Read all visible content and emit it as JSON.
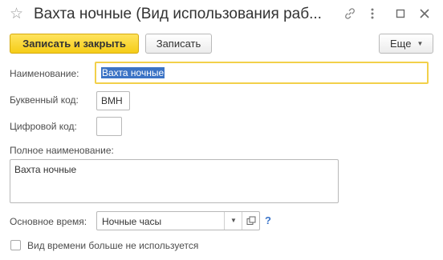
{
  "window": {
    "title": "Вахта ночные (Вид использования раб...",
    "star_icon": "star-icon",
    "link_icon": "link-icon",
    "more_icon": "kebab-icon",
    "restore_icon": "restore-icon",
    "close_icon": "close-icon"
  },
  "toolbar": {
    "save_close_label": "Записать и закрыть",
    "save_label": "Записать",
    "more_label": "Еще",
    "more_arrow_icon": "dropdown-arrow-icon"
  },
  "form": {
    "name_label": "Наименование:",
    "name_value": "Вахта ночные",
    "letter_code_label": "Буквенный код:",
    "letter_code_value": "ВМН",
    "digit_code_label": "Цифровой код:",
    "digit_code_value": "",
    "full_name_label": "Полное наименование:",
    "full_name_value": "Вахта ночные",
    "base_time_label": "Основное время:",
    "base_time_value": "Ночные часы",
    "help_mark": "?",
    "not_used_label": "Вид времени больше не используется",
    "not_used_checked": false
  },
  "colors": {
    "primary_button": "#f5cd17",
    "focus_border": "#f2d04a",
    "selection": "#3b73c5",
    "help": "#3a74c9"
  }
}
